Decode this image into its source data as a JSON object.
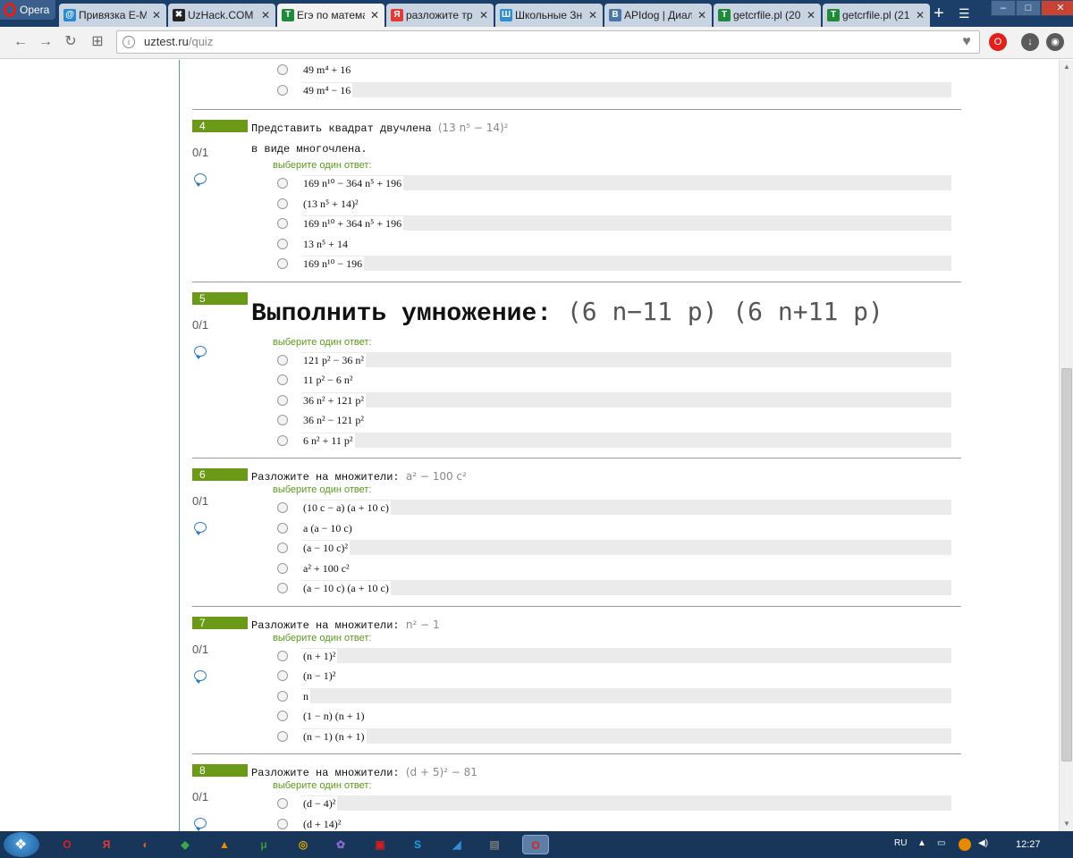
{
  "browser": {
    "opera_label": "Opera",
    "tabs": [
      {
        "label": "Привязка E-M",
        "icon_color": "#2a8ad4",
        "icon_char": "@",
        "active": false
      },
      {
        "label": "UzHack.COM",
        "icon_color": "#222222",
        "icon_char": "✖",
        "active": false
      },
      {
        "label": "Егэ по матема",
        "icon_color": "#1f8a3a",
        "icon_char": "T",
        "active": true
      },
      {
        "label": "разложите тр",
        "icon_color": "#e53935",
        "icon_char": "Я",
        "active": false
      },
      {
        "label": "Школьные Зн",
        "icon_color": "#2f8fd0",
        "icon_char": "Ш",
        "active": false
      },
      {
        "label": "APIdog | Диал",
        "icon_color": "#4a76a8",
        "icon_char": "B",
        "active": false
      },
      {
        "label": "getcrfile.pl (20",
        "icon_color": "#1f8a3a",
        "icon_char": "T",
        "active": false
      },
      {
        "label": "getcrfile.pl (21",
        "icon_color": "#1f8a3a",
        "icon_char": "T",
        "active": false
      }
    ],
    "tab_close_glyph": "✕",
    "new_tab_glyph": "+",
    "menu_glyph": "☰",
    "window_buttons": {
      "minimize": "–",
      "maximize": "□",
      "close": "✕"
    },
    "nav": {
      "back": "←",
      "forward": "→",
      "reload": "↻",
      "speed_dial": "⊞"
    },
    "url_host": "uztest.ru",
    "url_path": "/quiz"
  },
  "quiz": {
    "choose_label": "выберите один ответ:",
    "top_answers": [
      {
        "text": "49 m⁴ + 16",
        "shaded": false
      },
      {
        "text": "49 m⁴ − 16",
        "shaded": true
      }
    ],
    "questions": [
      {
        "number": "4",
        "score": "0/1",
        "text": "Представить квадрат двучлена",
        "math": "(13 n⁵ − 14)²",
        "text2": "в виде многочлена.",
        "answers": [
          {
            "text": "169 n¹⁰ − 364 n⁵ + 196",
            "shaded": true
          },
          {
            "text": "(13 n⁵ + 14)²",
            "shaded": false
          },
          {
            "text": "169 n¹⁰ + 364 n⁵ + 196",
            "shaded": true
          },
          {
            "text": "13 n⁵ + 14",
            "shaded": false
          },
          {
            "text": "169 n¹⁰ − 196",
            "shaded": true
          }
        ]
      },
      {
        "number": "5",
        "score": "0/1",
        "text": "Выполнить умножение:",
        "math": "(6 n−11 p) (6 n+11 p)",
        "answers": [
          {
            "text": "121 p² − 36 n²",
            "shaded": true
          },
          {
            "text": "11 p² − 6 n²",
            "shaded": false
          },
          {
            "text": "36 n² + 121 p²",
            "shaded": true
          },
          {
            "text": "36 n² − 121 p²",
            "shaded": false
          },
          {
            "text": "6 n² + 11 p²",
            "shaded": true
          }
        ]
      },
      {
        "number": "6",
        "score": "0/1",
        "text": "Разложите на множители:",
        "math": "a² − 100 c²",
        "answers": [
          {
            "text": "(10 c − a) (a + 10 c)",
            "shaded": true
          },
          {
            "text": "a (a − 10 c)",
            "shaded": false
          },
          {
            "text": "(a − 10 c)²",
            "shaded": true
          },
          {
            "text": "a² + 100 c²",
            "shaded": false
          },
          {
            "text": "(a − 10 c) (a + 10 c)",
            "shaded": true
          }
        ]
      },
      {
        "number": "7",
        "score": "0/1",
        "text": "Разложите на множители:",
        "math": "n² − 1",
        "answers": [
          {
            "text": "(n + 1)²",
            "shaded": true
          },
          {
            "text": "(n − 1)²",
            "shaded": false
          },
          {
            "text": "n",
            "shaded": true
          },
          {
            "text": "(1 − n) (n + 1)",
            "shaded": false
          },
          {
            "text": "(n − 1) (n + 1)",
            "shaded": true
          }
        ]
      },
      {
        "number": "8",
        "score": "0/1",
        "text": "Разложите на множители:",
        "math": "(d + 5)² − 81",
        "answers": [
          {
            "text": "(d − 4)²",
            "shaded": true
          },
          {
            "text": "(d + 14)²",
            "shaded": false
          }
        ]
      }
    ]
  },
  "taskbar": {
    "apps": [
      {
        "glyph": "O",
        "color": "#e0201b"
      },
      {
        "glyph": "Я",
        "color": "#e53935"
      },
      {
        "glyph": "◐",
        "color": "#e8562a"
      },
      {
        "glyph": "◆",
        "color": "#3aa845"
      },
      {
        "glyph": "▲",
        "color": "#f08a00"
      },
      {
        "glyph": "μ",
        "color": "#3a9a3a"
      },
      {
        "glyph": "◎",
        "color": "#d8a800"
      },
      {
        "glyph": "✿",
        "color": "#8a6ad0"
      },
      {
        "glyph": "▣",
        "color": "#d02020"
      },
      {
        "glyph": "S",
        "color": "#1aa0e8"
      },
      {
        "glyph": "◢",
        "color": "#3a8ad0"
      },
      {
        "glyph": "▤",
        "color": "#777777"
      },
      {
        "glyph": "O",
        "color": "#e0201b"
      }
    ],
    "language": "RU",
    "time": "12:27"
  }
}
